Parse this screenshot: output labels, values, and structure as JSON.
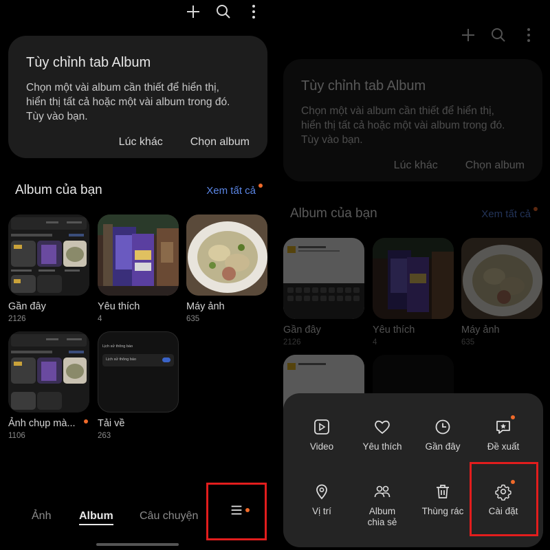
{
  "header": {
    "add_icon": "plus-icon",
    "search_icon": "search-icon",
    "more_icon": "more-vertical-icon"
  },
  "customize_card": {
    "title": "Tùy chỉnh tab Album",
    "text_line1": "Chọn một vài album cần thiết để hiển thị,",
    "text_line2": "hiển thị tất cả hoặc một vài album trong đó.",
    "text_line3": "Tùy vào bạn.",
    "later_label": "Lúc khác",
    "choose_label": "Chọn album"
  },
  "albums_section": {
    "title": "Album của bạn",
    "see_all": "Xem tất cả"
  },
  "albums": [
    {
      "name": "Gần đây",
      "count": "2126"
    },
    {
      "name": "Yêu thích",
      "count": "4"
    },
    {
      "name": "Máy ảnh",
      "count": "635"
    },
    {
      "name": "Ảnh chụp mà...",
      "count": "1106"
    },
    {
      "name": "Tải về",
      "count": "263"
    }
  ],
  "nested": {
    "title": "Lịch sử thông báo",
    "row": "Lịch sử thông báo"
  },
  "tabs": {
    "photos": "Ảnh",
    "albums": "Album",
    "stories": "Câu chuyện"
  },
  "menu": {
    "video": "Video",
    "favorites": "Yêu thích",
    "recent": "Gần đây",
    "suggest": "Đề xuất",
    "location": "Vị trí",
    "shared_album_line1": "Album",
    "shared_album_line2": "chia sẻ",
    "trash": "Thùng rác",
    "settings": "Cài đặt"
  },
  "colors": {
    "accent_blue": "#5b86e5",
    "badge_orange": "#f06a2a",
    "highlight_red": "#e21d1d"
  }
}
